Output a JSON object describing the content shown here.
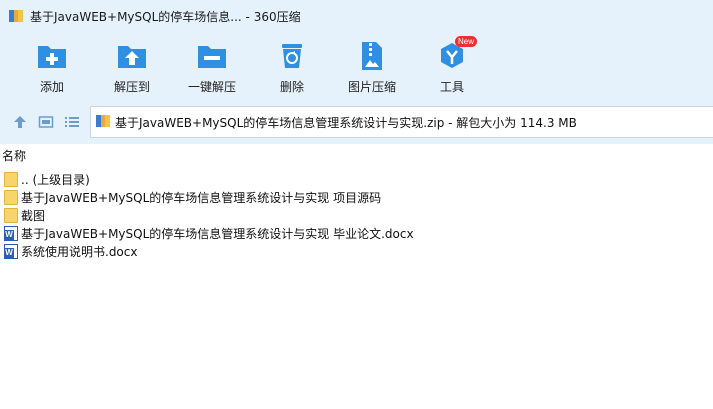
{
  "window": {
    "title": "基于JavaWEB+MySQL的停车场信息... - 360压缩"
  },
  "toolbar": {
    "items": [
      {
        "label": "添加",
        "icon": "add-icon"
      },
      {
        "label": "解压到",
        "icon": "extract-to-icon"
      },
      {
        "label": "一键解压",
        "icon": "one-click-extract-icon"
      },
      {
        "label": "删除",
        "icon": "delete-icon"
      },
      {
        "label": "图片压缩",
        "icon": "image-compress-icon"
      },
      {
        "label": "工具",
        "icon": "tools-icon",
        "badge": "New"
      }
    ],
    "accent_color": "#2f8fe0",
    "badge_color": "#e8322f"
  },
  "address": {
    "text": "基于JavaWEB+MySQL的停车场信息管理系统设计与实现.zip - 解包大小为 114.3 MB"
  },
  "list": {
    "column_header": "名称",
    "rows": [
      {
        "name": ".. (上级目录)",
        "icon": "folder-icon"
      },
      {
        "name": "基于JavaWEB+MySQL的停车场信息管理系统设计与实现 项目源码",
        "icon": "folder-icon"
      },
      {
        "name": "截图",
        "icon": "folder-icon"
      },
      {
        "name": "基于JavaWEB+MySQL的停车场信息管理系统设计与实现 毕业论文.docx",
        "icon": "word-doc-icon"
      },
      {
        "name": "系统使用说明书.docx",
        "icon": "word-doc-icon"
      }
    ]
  }
}
